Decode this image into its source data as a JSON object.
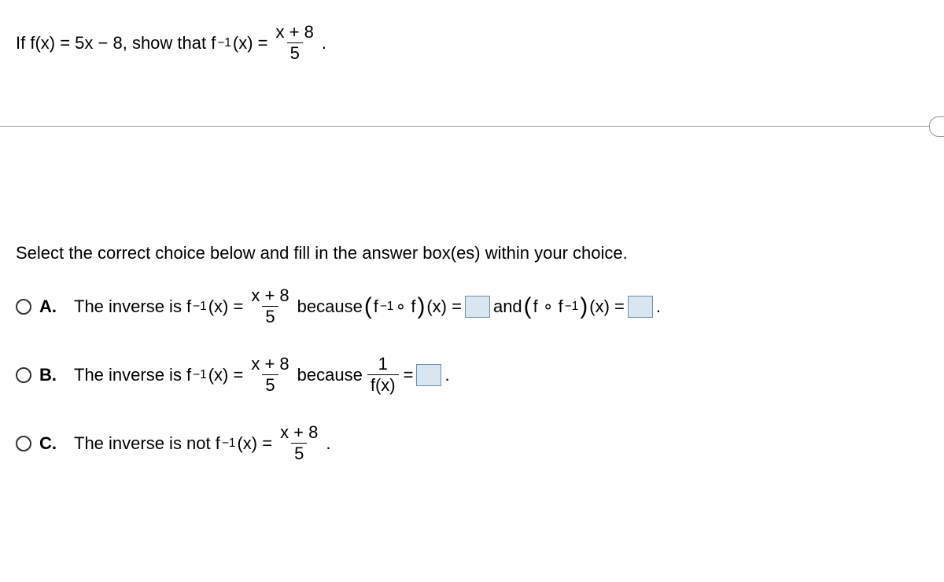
{
  "question": {
    "leadin": "If f(x) = 5x − 8, show that f",
    "exp": " −1",
    "after_exp": "(x) =",
    "frac_num": "x + 8",
    "frac_den": "5",
    "trail": "."
  },
  "instruction": "Select the correct choice below and fill in the answer box(es) within your choice.",
  "choices": {
    "A": {
      "label": "A.",
      "t1": "The inverse is f",
      "exp": " −1",
      "t2": "(x) =",
      "frac_num": "x + 8",
      "frac_den": "5",
      "t3": " because ",
      "p1a": "f",
      "p1exp": " −1",
      "p1b": " ∘ f",
      "t4": " (x) = ",
      "t5": " and ",
      "p2a": "f ∘ f",
      "p2exp": " −1",
      "t6": " (x) = ",
      "t7": "."
    },
    "B": {
      "label": "B.",
      "t1": "The inverse is f",
      "exp": " −1",
      "t2": "(x) =",
      "frac_num": "x + 8",
      "frac_den": "5",
      "t3": " because ",
      "f2_num": "1",
      "f2_den": "f(x)",
      "t4": " = ",
      "t5": "."
    },
    "C": {
      "label": "C.",
      "t1": "The inverse is not f",
      "exp": " −1",
      "t2": "(x) =",
      "frac_num": "x + 8",
      "frac_den": "5",
      "t3": "."
    }
  }
}
